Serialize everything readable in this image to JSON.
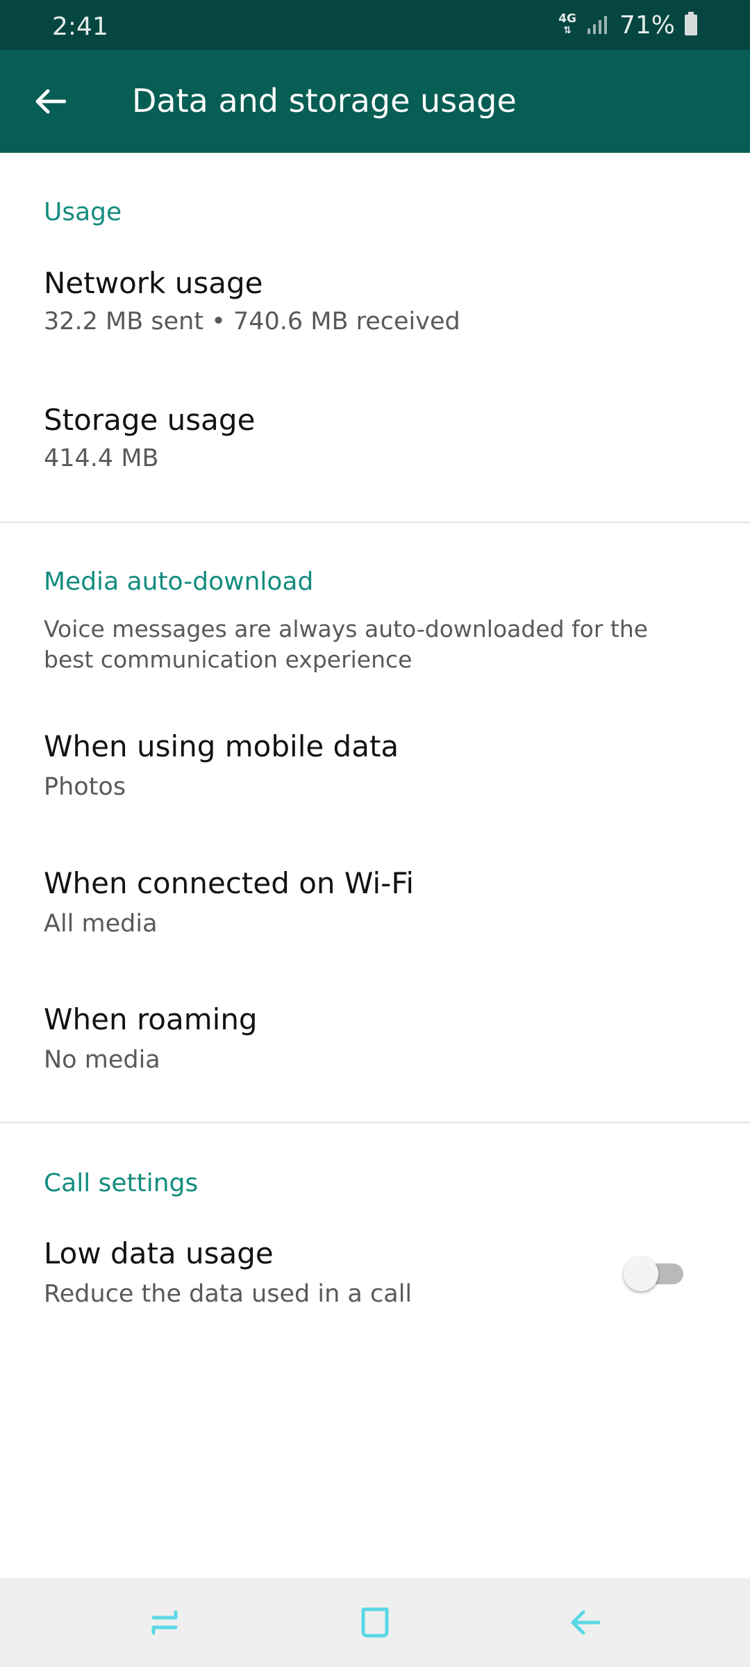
{
  "status_bar": {
    "time": "2:41",
    "network": "4G",
    "battery": "71%"
  },
  "app_bar": {
    "title": "Data and storage usage"
  },
  "usage": {
    "header": "Usage",
    "network_title": "Network usage",
    "network_sub": "32.2 MB sent • 740.6 MB received",
    "storage_title": "Storage usage",
    "storage_sub": "414.4 MB"
  },
  "media": {
    "header": "Media auto-download",
    "description": "Voice messages are always auto-downloaded for the best communication experience",
    "mobile_title": "When using mobile data",
    "mobile_sub": "Photos",
    "wifi_title": "When connected on Wi-Fi",
    "wifi_sub": "All media",
    "roaming_title": "When roaming",
    "roaming_sub": "No media"
  },
  "calls": {
    "header": "Call settings",
    "low_data_title": "Low data usage",
    "low_data_sub": "Reduce the data used in a call",
    "low_data_enabled": false
  },
  "colors": {
    "status_bar": "#054640",
    "app_bar": "#075e54",
    "accent": "#128c7e",
    "nav_icons": "#5ad8e6"
  }
}
